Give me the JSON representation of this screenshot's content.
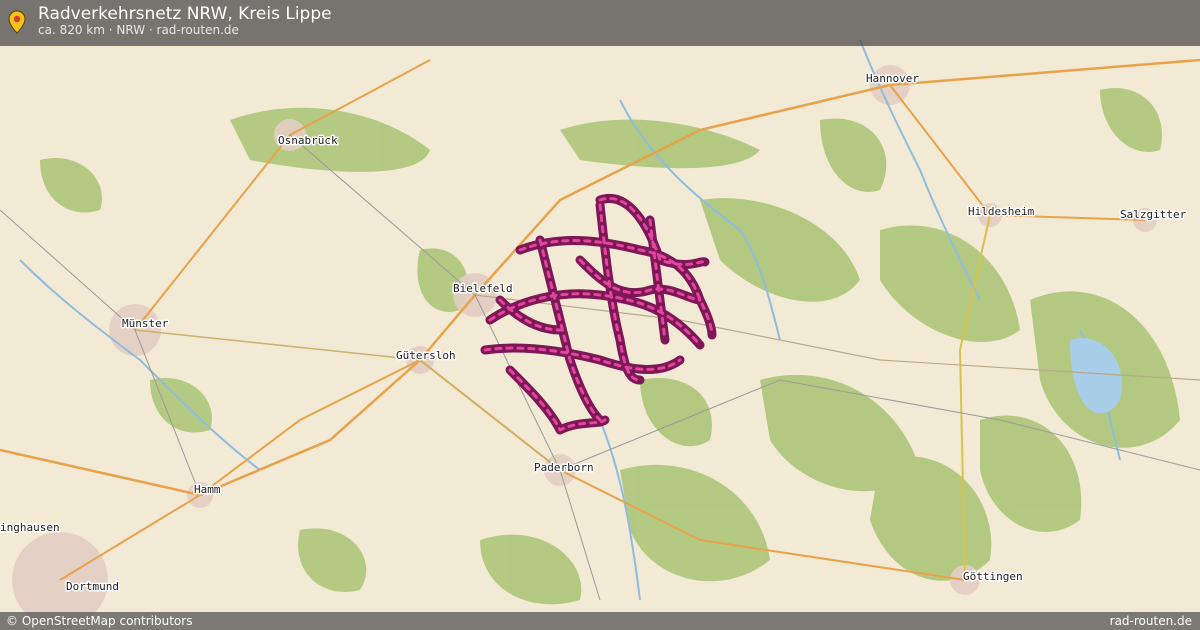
{
  "header": {
    "title": "Radverkehrsnetz NRW, Kreis Lippe",
    "subtitle": "ca. 820 km · NRW · rad-routen.de",
    "pin_icon": "location-pin-icon"
  },
  "map": {
    "cities": [
      {
        "key": "osnabrueck",
        "name": "Osnabrück"
      },
      {
        "key": "hannover",
        "name": "Hannover"
      },
      {
        "key": "hildesheim",
        "name": "Hildesheim"
      },
      {
        "key": "salzgitter",
        "name": "Salzgitter"
      },
      {
        "key": "bielefeld",
        "name": "Bielefeld"
      },
      {
        "key": "muenster",
        "name": "Münster"
      },
      {
        "key": "guetersloh",
        "name": "Gütersloh"
      },
      {
        "key": "paderborn",
        "name": "Paderborn"
      },
      {
        "key": "hamm",
        "name": "Hamm"
      },
      {
        "key": "dortmund",
        "name": "Dortmund"
      },
      {
        "key": "goettingen",
        "name": "Göttingen"
      },
      {
        "key": "recklinghausen",
        "name": "inghausen"
      }
    ],
    "route_color": "#8b1a5e",
    "route_marker_color": "#e2459f",
    "land_color": "#f2ead8",
    "forest_color": "#9fbd6a",
    "water_color": "#9fc8e8"
  },
  "footer": {
    "attribution": "© OpenStreetMap contributors",
    "site": "rad-routen.de"
  }
}
